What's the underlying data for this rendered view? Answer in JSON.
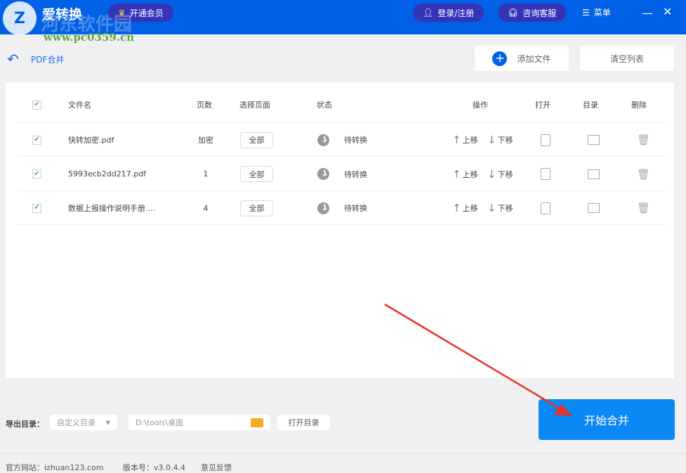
{
  "app": {
    "title": "爱转换",
    "vip_label": "开通会员",
    "login_label": "登录/注册",
    "support_label": "咨询客服",
    "menu_label": "菜单"
  },
  "watermark": {
    "name": "河东软件园",
    "url": "www.pc0359.cn"
  },
  "page": {
    "title": "PDF合并",
    "add_files": "添加文件",
    "clear_list": "清空列表"
  },
  "table": {
    "headers": {
      "name": "文件名",
      "pages": "页数",
      "select": "选择页面",
      "status": "状态",
      "ops": "操作",
      "open": "打开",
      "dir": "目录",
      "delete": "删除"
    },
    "rows": [
      {
        "name": "快转加密.pdf",
        "pages": "加密",
        "select": "全部",
        "status": "待转换",
        "up": "上移",
        "down": "下移",
        "checked": true
      },
      {
        "name": "5993ecb2dd217.pdf",
        "pages": "1",
        "select": "全部",
        "status": "待转换",
        "up": "上移",
        "down": "下移",
        "checked": true
      },
      {
        "name": "数据上报操作说明手册....",
        "pages": "4",
        "select": "全部",
        "status": "待转换",
        "up": "上移",
        "down": "下移",
        "checked": true
      }
    ]
  },
  "output": {
    "label": "导出目录：",
    "mode": "自定义目录",
    "path": "D:\\tools\\桌面",
    "open_dir": "打开目录",
    "start": "开始合并"
  },
  "footer": {
    "site": "官方网站：izhuan123.com",
    "version": "版本号：v3.0.4.4",
    "feedback": "意见反馈"
  },
  "colors": {
    "header": "#0060e6",
    "pill": "#3434b8",
    "start": "#0a88f5",
    "annotation": "#e8332a"
  }
}
